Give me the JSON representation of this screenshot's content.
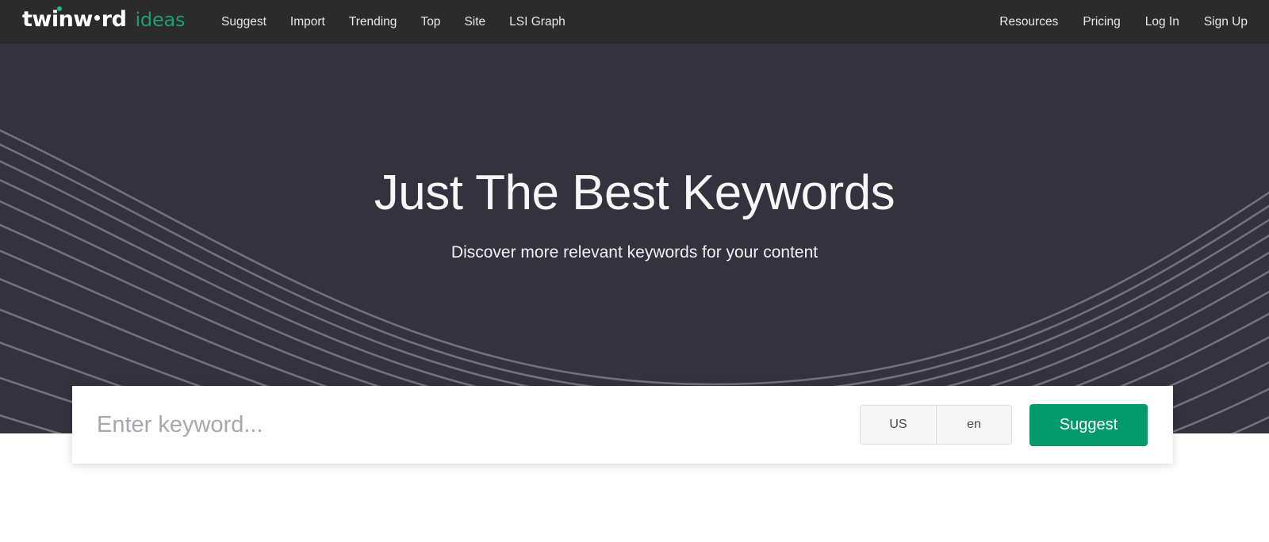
{
  "brand": {
    "mark_part1": "twinw",
    "mark_part2": "rd",
    "sub": "ideas",
    "accent_color": "#1d9e73"
  },
  "nav": {
    "left_items": [
      {
        "label": "Suggest"
      },
      {
        "label": "Import"
      },
      {
        "label": "Trending"
      },
      {
        "label": "Top"
      },
      {
        "label": "Site"
      },
      {
        "label": "LSI Graph"
      }
    ],
    "right_items": [
      {
        "label": "Resources"
      },
      {
        "label": "Pricing"
      },
      {
        "label": "Log In"
      },
      {
        "label": "Sign Up"
      }
    ]
  },
  "hero": {
    "title": "Just The Best Keywords",
    "subtitle": "Discover more relevant keywords for your content",
    "background_color": "#34323f",
    "wave_line_color": "#9a99a8"
  },
  "search": {
    "placeholder": "Enter keyword...",
    "value": "",
    "country": "US",
    "language": "en",
    "submit_label": "Suggest",
    "submit_color": "#039a6b"
  },
  "theme": {
    "topbar_color": "#2b2b2b",
    "page_background": "#ffffff"
  }
}
